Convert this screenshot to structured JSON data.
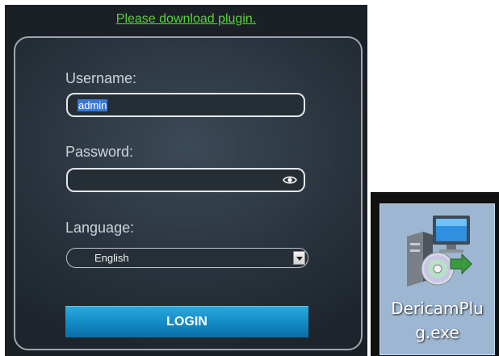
{
  "plugin_link": "Please download plugin.",
  "login": {
    "username_label": "Username:",
    "username_value": "admin",
    "password_label": "Password:",
    "password_value": "",
    "language_label": "Language:",
    "language_selected": "English",
    "login_button": "LOGIN"
  },
  "desktop_file": {
    "name_line1": "DericamPlu",
    "name_line2": "g.exe",
    "icon": "installer-icon"
  },
  "colors": {
    "link": "#58d33a",
    "login_button": "#1389c4",
    "panel_bg": "#2a343e"
  }
}
